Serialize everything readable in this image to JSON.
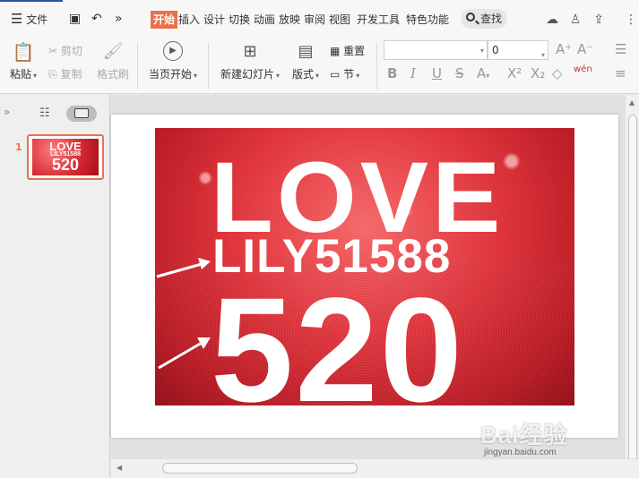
{
  "menubar": {
    "menu_label": "文件",
    "more": "»",
    "tabs": [
      "开始",
      "插入",
      "设计",
      "切换",
      "动画",
      "放映",
      "审阅",
      "视图",
      "开发工具",
      "特色功能"
    ],
    "active_tab": "开始",
    "search_label": "查找"
  },
  "ribbon": {
    "paste": "粘贴",
    "cut": "剪切",
    "copy": "复制",
    "format_painter": "格式刷",
    "play_from_current": "当页开始",
    "new_slide": "新建幻灯片",
    "layout": "版式",
    "reset": "重置",
    "section": "节",
    "font_size_value": "0",
    "phonetic": "wén"
  },
  "slides_panel": {
    "expand": "»",
    "slide_number": "1",
    "thumb_line1": "LOVE",
    "thumb_line2": "LILY51588",
    "thumb_line3": "520"
  },
  "slide": {
    "line1": "LOVE",
    "line2": "LILY51588",
    "line3": "520"
  },
  "watermark": {
    "brand": "Bai经验",
    "url": "jingyan.baidu.com"
  },
  "colors": {
    "accent": "#e8734a",
    "photo_red": "#d2252f"
  }
}
